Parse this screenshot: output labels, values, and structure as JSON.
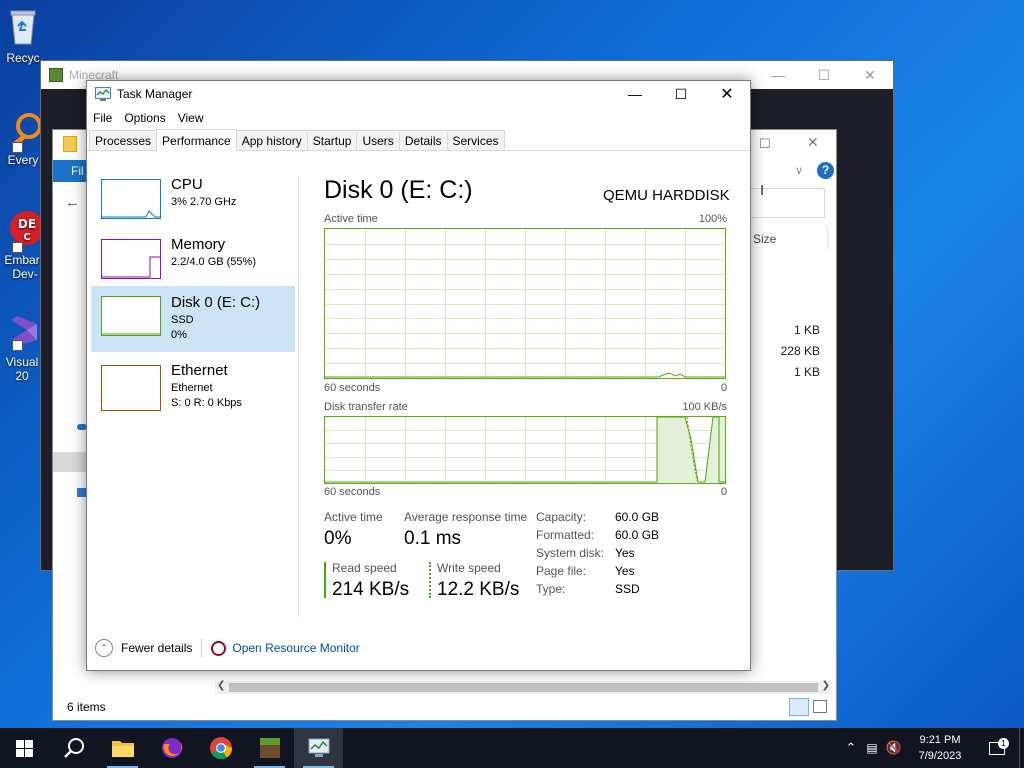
{
  "desktop": {
    "icons": [
      {
        "label": "Recyc"
      },
      {
        "label": "Every"
      },
      {
        "label": "Embarc Dev-"
      },
      {
        "label": "Visual 20"
      }
    ]
  },
  "minecraft_window": {
    "title": "Minecraft"
  },
  "explorer_window": {
    "column_size": "Size",
    "sizes": [
      "1 KB",
      "228 KB",
      "1 KB"
    ],
    "status": "6 items",
    "file_tab": "Fil"
  },
  "task_manager": {
    "title": "Task Manager",
    "menu": [
      "File",
      "Options",
      "View"
    ],
    "tabs": [
      "Processes",
      "Performance",
      "App history",
      "Startup",
      "Users",
      "Details",
      "Services"
    ],
    "active_tab": "Performance",
    "sidebar": [
      {
        "name": "CPU",
        "sub1": "3% 2.70 GHz",
        "sub2": "",
        "color": "#117dbb"
      },
      {
        "name": "Memory",
        "sub1": "2.2/4.0 GB (55%)",
        "sub2": "",
        "color": "#8b12ae"
      },
      {
        "name": "Disk 0 (E: C:)",
        "sub1": "SSD",
        "sub2": "0%",
        "color": "#4da60c"
      },
      {
        "name": "Ethernet",
        "sub1": "Ethernet",
        "sub2": "S: 0 R: 0 Kbps",
        "color": "#a74f01"
      }
    ],
    "disk": {
      "title": "Disk 0 (E: C:)",
      "model": "QEMU HARDDISK",
      "graph1": {
        "label": "Active time",
        "max": "100%",
        "time": "60 seconds",
        "min": "0"
      },
      "graph2": {
        "label": "Disk transfer rate",
        "max": "100 KB/s",
        "time": "60 seconds",
        "min": "0"
      },
      "active_time_label": "Active time",
      "active_time": "0%",
      "avg_response_label": "Average response time",
      "avg_response": "0.1 ms",
      "read_label": "Read speed",
      "read": "214 KB/s",
      "write_label": "Write speed",
      "write": "12.2 KB/s",
      "props": [
        {
          "k": "Capacity:",
          "v": "60.0 GB"
        },
        {
          "k": "Formatted:",
          "v": "60.0 GB"
        },
        {
          "k": "System disk:",
          "v": "Yes"
        },
        {
          "k": "Page file:",
          "v": "Yes"
        },
        {
          "k": "Type:",
          "v": "SSD"
        }
      ]
    },
    "footer": {
      "fewer_details": "Fewer details",
      "resource_monitor": "Open Resource Monitor"
    }
  },
  "taskbar": {
    "time": "9:21 PM",
    "date": "7/9/2023",
    "notification_count": "1"
  }
}
